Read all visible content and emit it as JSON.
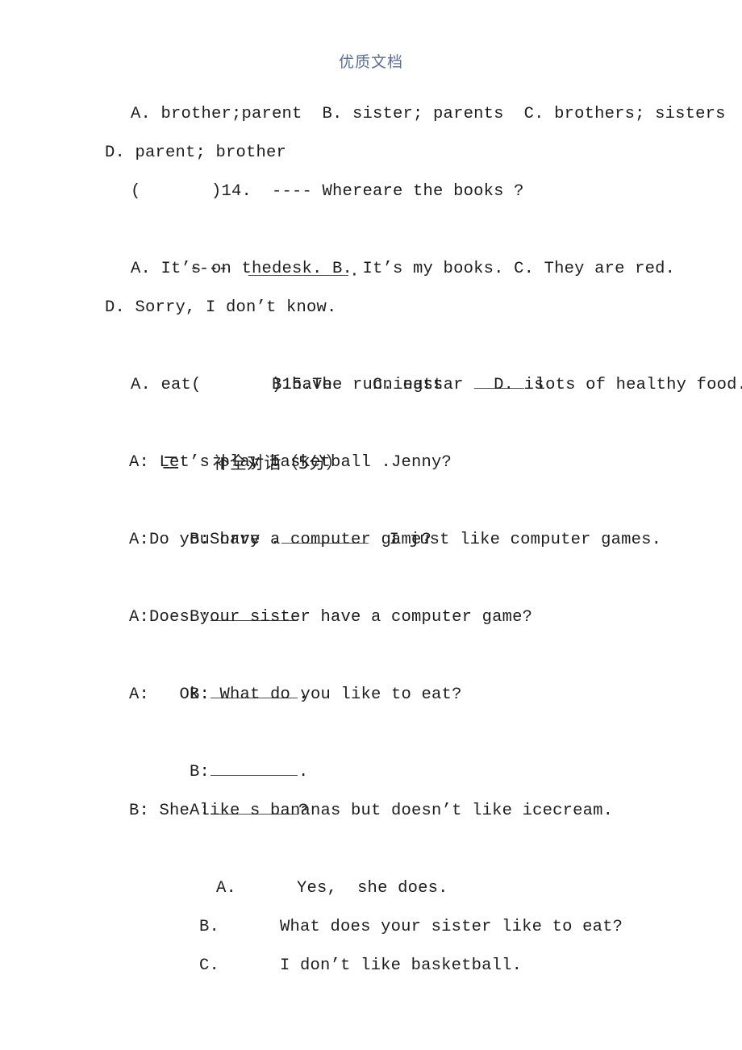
{
  "document": {
    "header_watermark": "优质文档",
    "header_color": "#5b6f8f",
    "background_color": "#ffffff",
    "text_color": "#1d1d1d"
  },
  "section_one_tail": {
    "q13_options_line1": "A. brother;parent  B. sister; parents  C. brothers; sisters",
    "q13_options_line2": "D. parent; brother",
    "q14_number": "(       )14.  ---- Whereare the books ?",
    "q14_answer_prefix": "----",
    "q14_answer_suffix": ".",
    "q14_options_line1": "A. It’s on thedesk. B. It’s my books. C. They are red.",
    "q14_options_line2": "D. Sorry, I don’t know.",
    "q15_number_a": "(       )15.",
    "q15_number_b": "The runningstar",
    "q15_number_c": "lots of healthy food.",
    "q15_options": "A. eat        B.have    C. eats     D. is"
  },
  "section_two": {
    "heading_number": "二",
    "heading_title": "补全对话（5分）",
    "dialogue": [
      {
        "id": "d1",
        "text": "A: Let’s play basketball .Jenny?"
      },
      {
        "id": "d2",
        "prefix": "B:Sorry .",
        "suffix": "I just like computer games."
      },
      {
        "id": "d3",
        "text": "A:Do you have a computer game?"
      },
      {
        "id": "d4",
        "prefix": "B:",
        "suffix": ""
      },
      {
        "id": "d5",
        "text": "A:Does your sister have a computer game?"
      },
      {
        "id": "d6",
        "prefix": "B:",
        "suffix": "."
      },
      {
        "id": "d7",
        "text": "A:   Ok. What do you like to eat?"
      },
      {
        "id": "d8",
        "prefix": "B:",
        "suffix": "."
      },
      {
        "id": "d9",
        "prefix": "A:",
        "suffix": "?"
      },
      {
        "id": "d10",
        "text": "B: She like s bananas but doesn’t like icecream."
      }
    ],
    "choices": [
      {
        "label": "A.",
        "text": "Yes,  she does."
      },
      {
        "label": "B.",
        "text": "What does your sister like to eat?"
      },
      {
        "label": "C.",
        "text": "I don’t like basketball."
      }
    ]
  }
}
